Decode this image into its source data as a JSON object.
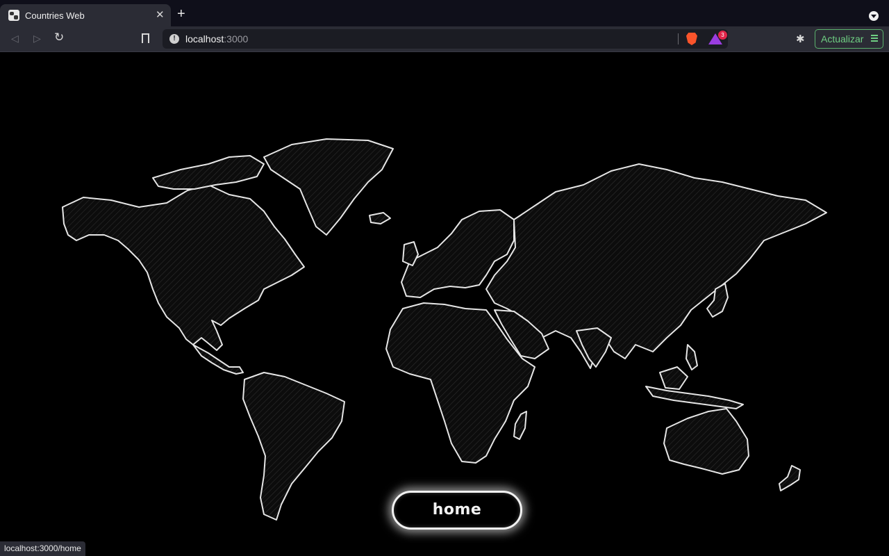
{
  "browser": {
    "tab": {
      "title": "Countries Web",
      "close_glyph": "✕",
      "favicon": "globe-map-favicon"
    },
    "new_tab_glyph": "+",
    "address": {
      "host": "localhost",
      "port": ":3000"
    },
    "rewards_badge": "3",
    "update_label": "Actualizar",
    "status_url": "localhost:3000/home"
  },
  "page": {
    "home_label": "home"
  },
  "colors": {
    "background": "#000000",
    "map_outline": "#e6e6e6",
    "accent_update": "#6fcf83"
  }
}
